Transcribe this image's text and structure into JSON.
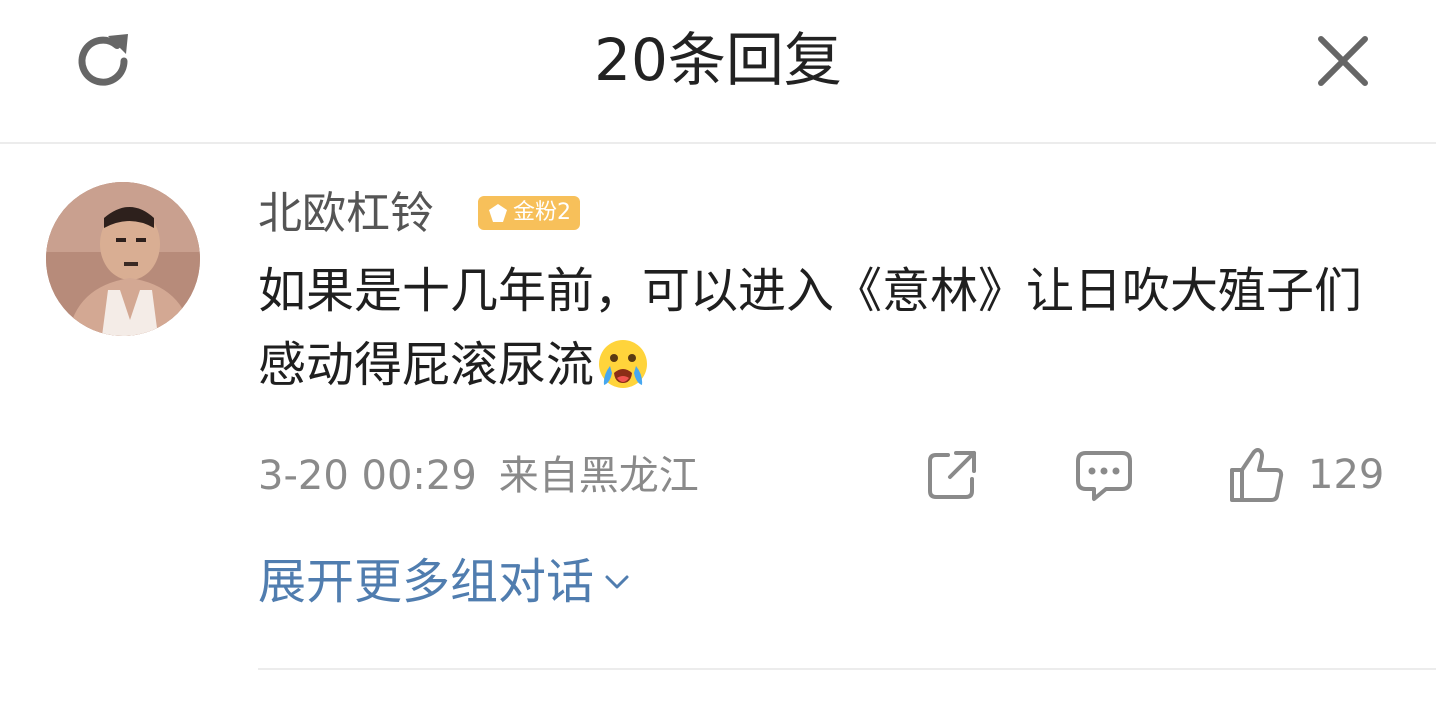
{
  "header": {
    "title": "20条回复",
    "refresh_icon": "refresh-icon",
    "close_icon": "close-icon"
  },
  "comment": {
    "username": "北欧杠铃",
    "badge": "金粉2",
    "text": "如果是十几年前，可以进入《意林》让日吹大殖子们感动得屁滚尿流",
    "emoji": "crying-face-emoji",
    "timestamp": "3-20 00:29",
    "location": "来自黑龙江",
    "like_count": "129"
  },
  "expand": {
    "label": "展开更多组对话"
  },
  "colors": {
    "link": "#507daf",
    "meta": "#8a8a8a",
    "badge": "#f7c05a",
    "divider": "#ececec"
  }
}
